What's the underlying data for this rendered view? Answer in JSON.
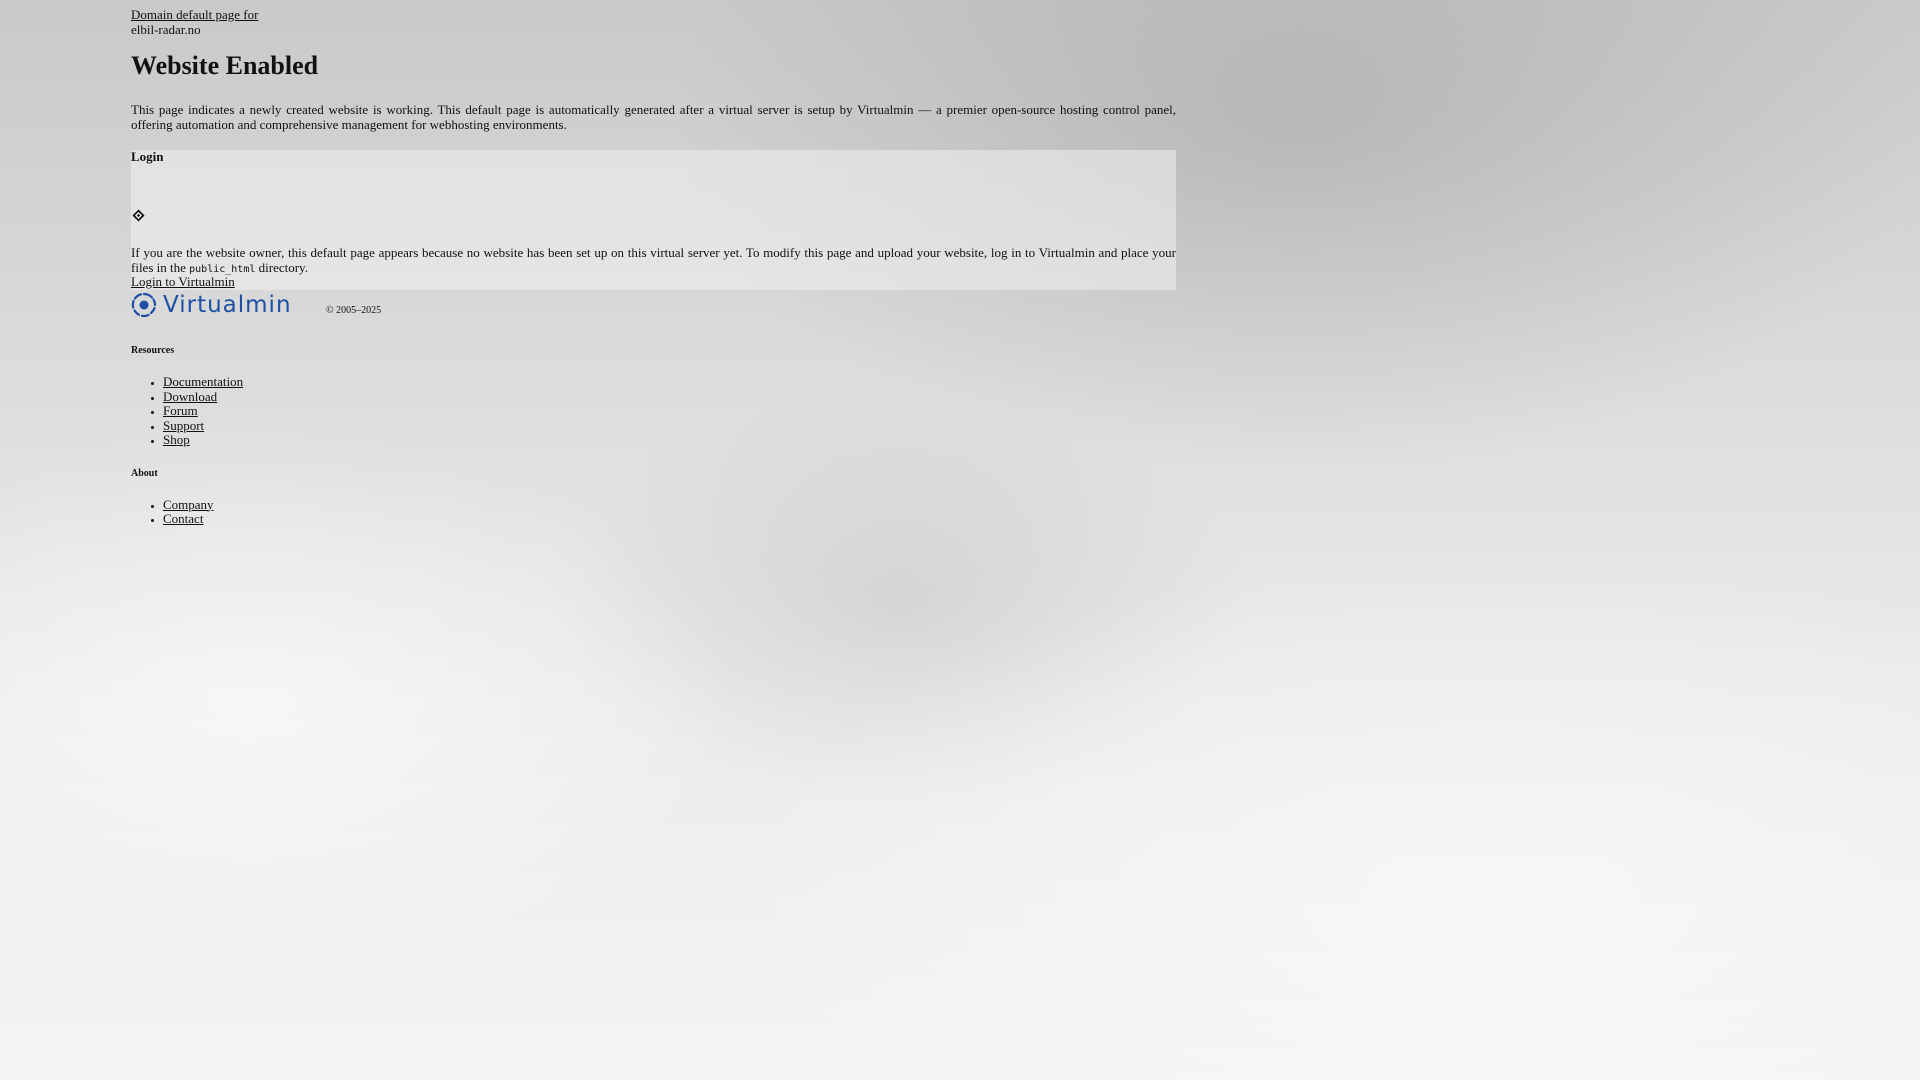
{
  "header": {
    "domain_link_label": "Domain default page for",
    "domain_name": "elbil-radar.no"
  },
  "main": {
    "title": "Website Enabled",
    "intro": "This page indicates a newly created website is working. This default page is automatically generated after a virtual server is setup by Virtualmin — a premier open-source hosting control panel, offering automation and comprehensive management for webhosting environments."
  },
  "login": {
    "title": "Login",
    "icon": "diamond-icon",
    "owner_text_before": "If you are the website owner, this default page appears because no website has been set up on this virtual server yet. To modify this page and upload your website, log in to Virtualmin and place your files in the ",
    "owner_code": "public_html",
    "owner_text_after": " directory.",
    "link_label": "Login to Virtualmin"
  },
  "brand": {
    "wordmark": "Virtualmin",
    "logo_color": "#1d4fa6",
    "copyright": "© 2005–2025"
  },
  "resources": {
    "heading": "Resources",
    "items": [
      {
        "label": "Documentation"
      },
      {
        "label": "Download"
      },
      {
        "label": "Forum"
      },
      {
        "label": "Support"
      },
      {
        "label": "Shop"
      }
    ]
  },
  "about": {
    "heading": "About",
    "items": [
      {
        "label": "Company"
      },
      {
        "label": "Contact"
      }
    ]
  }
}
